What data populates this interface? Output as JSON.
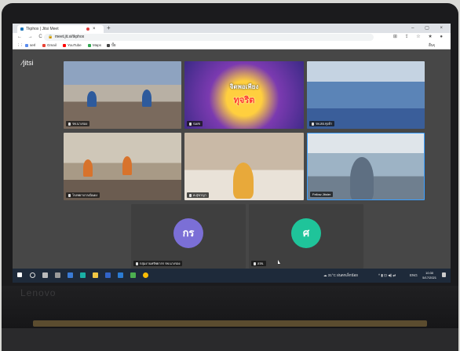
{
  "laptop": {
    "brand": "Lenovo"
  },
  "browser": {
    "tab_title": "Tkphox | Jitsi Meet",
    "new_tab": "+",
    "tab_close": "×",
    "window_controls": "–  ▢  ×",
    "url": "meet.jit.si/tkphox",
    "nav_glyphs": "←  →  C",
    "lock_glyph": "🔒",
    "ext_glyphs": "⊞ ⇪ ☆ ★ ●",
    "bookmarks": [
      {
        "label": "serl",
        "color": "#5b8def"
      },
      {
        "label": "Gmail",
        "color": "#ea4335"
      },
      {
        "label": "YouTube",
        "color": "#ff0000"
      },
      {
        "label": "Maps",
        "color": "#34a853"
      },
      {
        "label": "ปั๊ย",
        "color": "#444444"
      }
    ],
    "bookmarks_right": "อื่นๆ"
  },
  "jitsi": {
    "logo": "jitsi",
    "poster_title": "จิตพอเพียง",
    "poster_sub": "ทุจริต",
    "tiles": [
      {
        "label": "รพ.นางรอง"
      },
      {
        "label": "SARI"
      },
      {
        "label": "รพ.สต.ทุ่งจ้า"
      },
      {
        "label": "โรงพยาบาลเนินดง"
      },
      {
        "label": "ค.สุขาญา"
      },
      {
        "label": "Fellow Jitster"
      },
      {
        "label": "กลุ่มงานทรัพยากร รพ.นางรอง",
        "initials": "กร",
        "color": "#7b6fd6"
      },
      {
        "label": "สสจ.",
        "initials": "ศ",
        "color": "#1fc49a"
      }
    ]
  },
  "taskbar": {
    "weather": "31°C ฝนตกเล็กน้อย",
    "tray_icons": "^ ▮ ⊡ ◀) ⇄",
    "lang": "ENG",
    "time": "10:30",
    "date": "5/17/2021"
  }
}
